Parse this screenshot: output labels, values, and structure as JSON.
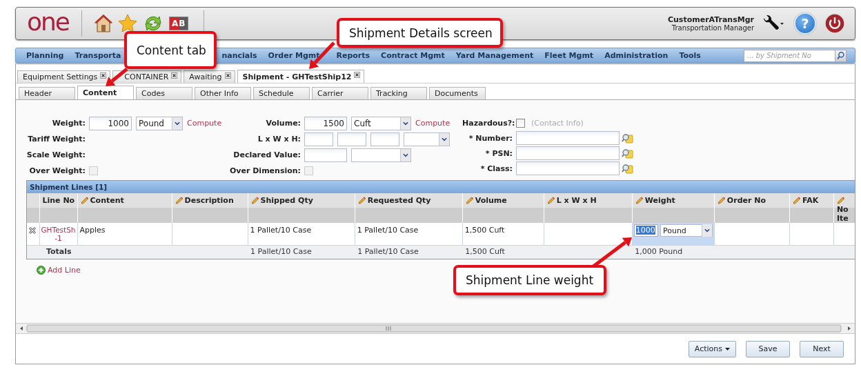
{
  "header": {
    "logo": "one",
    "badge": "AB",
    "user_name": "CustomerATransMgr",
    "user_role": "Transportation Manager",
    "help": "?"
  },
  "nav": {
    "items": [
      {
        "label": "Planning"
      },
      {
        "label": "Transporta"
      },
      {
        "label": "nancials"
      },
      {
        "label": "Order Mgmt"
      },
      {
        "label": "Reports"
      },
      {
        "label": "Contract Mgmt"
      },
      {
        "label": "Yard Management"
      },
      {
        "label": "Fleet Mgmt"
      },
      {
        "label": "Administration"
      },
      {
        "label": "Tools"
      }
    ],
    "search_placeholder": "... by Shipment No"
  },
  "tabs": [
    {
      "label": "Equipment Settings",
      "selected": false
    },
    {
      "label": "CONTAINER",
      "selected": false
    },
    {
      "label": "Awaiting",
      "selected": false
    },
    {
      "label": "Shipment - GHTestShip12",
      "selected": true
    }
  ],
  "subtabs": [
    {
      "label": "Header",
      "selected": false
    },
    {
      "label": "Content",
      "selected": true
    },
    {
      "label": "Codes",
      "selected": false
    },
    {
      "label": "Other Info",
      "selected": false
    },
    {
      "label": "Schedule",
      "selected": false
    },
    {
      "label": "Carrier",
      "selected": false
    },
    {
      "label": "Tracking",
      "selected": false
    },
    {
      "label": "Documents",
      "selected": false
    }
  ],
  "form": {
    "weight": {
      "label": "Weight:",
      "value": "1000",
      "unit": "Pound",
      "action": "Compute"
    },
    "tariff_weight": {
      "label": "Tariff Weight:"
    },
    "scale_weight": {
      "label": "Scale Weight:"
    },
    "over_weight": {
      "label": "Over Weight:",
      "checked": false,
      "disabled": true
    },
    "volume": {
      "label": "Volume:",
      "value": "1500",
      "unit": "Cuft",
      "action": "Compute"
    },
    "dimensions": {
      "label": "L x W x H:"
    },
    "declared_value": {
      "label": "Declared Value:"
    },
    "over_dimension": {
      "label": "Over Dimension:",
      "checked": false,
      "disabled": true
    },
    "hazardous": {
      "label": "Hazardous?:",
      "checked": false,
      "disabled": false,
      "link": "(Contact Info)",
      "link_disabled": true
    },
    "hazmat_fields": [
      {
        "label": "* Number:"
      },
      {
        "label": "* PSN:"
      },
      {
        "label": "* Class:"
      }
    ]
  },
  "shipment_lines": {
    "title": "Shipment Lines [1]",
    "columns": [
      {
        "label": "Line No",
        "editable": false
      },
      {
        "label": "Content",
        "editable": true
      },
      {
        "label": "Description",
        "editable": true
      },
      {
        "label": "Shipped Qty",
        "editable": true
      },
      {
        "label": "Requested Qty",
        "editable": true
      },
      {
        "label": "Volume",
        "editable": true
      },
      {
        "label": "L x W x H",
        "editable": true
      },
      {
        "label": "Weight",
        "editable": true
      },
      {
        "label": "Order No",
        "editable": true
      },
      {
        "label": "FAK",
        "editable": true
      },
      {
        "label": "No Ite",
        "editable": true
      }
    ],
    "rows": [
      {
        "cells": [
          {
            "kind": "link",
            "text": "GHTestSh -1"
          },
          {
            "kind": "text",
            "text": "Apples"
          },
          {
            "kind": "text"
          },
          {
            "kind": "text",
            "text": "1 Pallet/10 Case"
          },
          {
            "kind": "text",
            "text": "1 Pallet/10 Case"
          },
          {
            "kind": "text",
            "text": "1,500 Cuft"
          },
          {
            "kind": "text"
          },
          {
            "kind": "editor",
            "value": "1000",
            "unit": "Pound",
            "selected": true
          },
          {
            "kind": "text"
          },
          {
            "kind": "text"
          },
          {
            "kind": "text"
          }
        ]
      }
    ],
    "totals": [
      {
        "kind": "label",
        "text": "Totals"
      },
      {
        "kind": "blank"
      },
      {
        "kind": "blank"
      },
      {
        "kind": "value",
        "text": "1 Pallet/10 Case"
      },
      {
        "kind": "value",
        "text": "1 Pallet/10 Case"
      },
      {
        "kind": "value",
        "text": "1,500 Cuft"
      },
      {
        "kind": "blank"
      },
      {
        "kind": "value",
        "text": "1,000 Pound"
      },
      {
        "kind": "blank"
      },
      {
        "kind": "blank"
      },
      {
        "kind": "blank"
      }
    ],
    "add_link": "Add Line"
  },
  "footer_buttons": [
    {
      "label": "Actions",
      "kind": "menu"
    },
    {
      "label": "Save",
      "kind": "plain"
    },
    {
      "label": "Next",
      "kind": "plain"
    }
  ],
  "callouts": [
    {
      "text": "Content tab"
    },
    {
      "text": "Shipment Details screen"
    },
    {
      "text": "Shipment Line weight"
    }
  ]
}
